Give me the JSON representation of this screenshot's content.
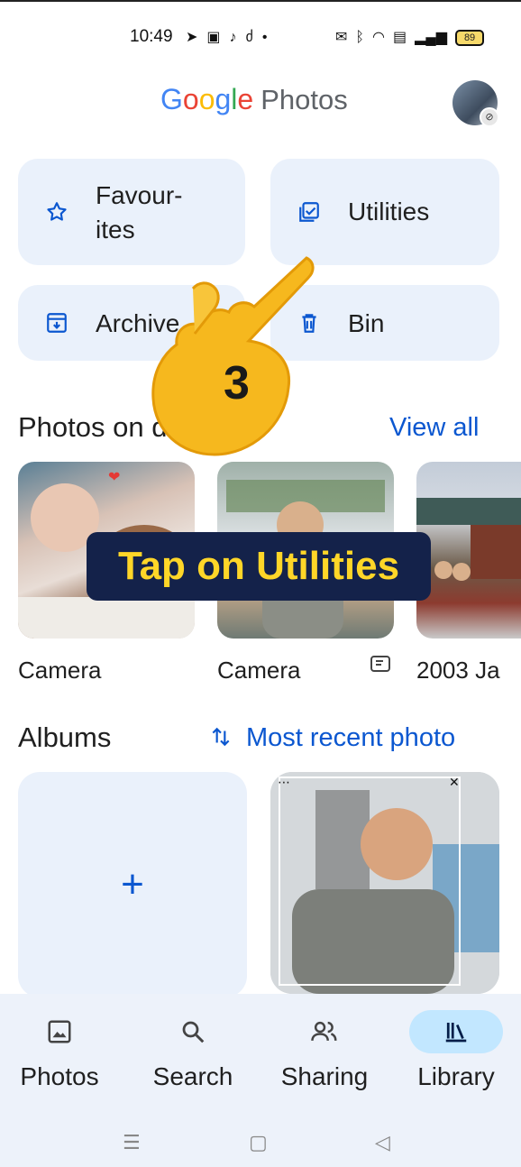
{
  "status_bar": {
    "time": "10:49",
    "left_icons": [
      "telegram-icon",
      "message-icon",
      "tiktok-icon",
      "tiktok-alt-icon",
      "dot-icon"
    ],
    "right_icons": [
      "vibrate-icon",
      "bluetooth-icon",
      "wifi-icon",
      "volte-icon",
      "signal-icon"
    ],
    "battery": "89"
  },
  "header": {
    "brand_letters": [
      "G",
      "o",
      "o",
      "g",
      "l",
      "e"
    ],
    "product": "Photos"
  },
  "tiles": [
    {
      "label": "Favour-\nites",
      "icon": "star-icon"
    },
    {
      "label": "Utilities",
      "icon": "utilities-icon"
    },
    {
      "label": "Archive",
      "icon": "archive-icon"
    },
    {
      "label": "Bin",
      "icon": "bin-icon"
    }
  ],
  "photos_on_device": {
    "title": "Photos on device",
    "view_all": "View all",
    "folders": [
      {
        "label": "Camera"
      },
      {
        "label": "Camera"
      },
      {
        "label": "2003 Ja"
      }
    ]
  },
  "albums": {
    "title": "Albums",
    "sort_label": "Most recent photo",
    "new_album_symbol": "+"
  },
  "overlay": {
    "step_number": "3",
    "caption": "Tap on Utilities"
  },
  "bottom_nav": [
    {
      "label": "Photos",
      "icon": "photo-icon",
      "active": false
    },
    {
      "label": "Search",
      "icon": "search-icon",
      "active": false
    },
    {
      "label": "Sharing",
      "icon": "sharing-icon",
      "active": false
    },
    {
      "label": "Library",
      "icon": "library-icon",
      "active": true
    }
  ],
  "system_nav": {
    "menu": "☰",
    "home": "▢",
    "back": "◁"
  },
  "colors": {
    "accent": "#0b57d0",
    "tile_bg": "#eaf1fb",
    "nav_bg": "#edf2fa",
    "active_pill": "#c2e7ff",
    "caption_text": "#ffd628",
    "caption_bg": "#14224a"
  }
}
